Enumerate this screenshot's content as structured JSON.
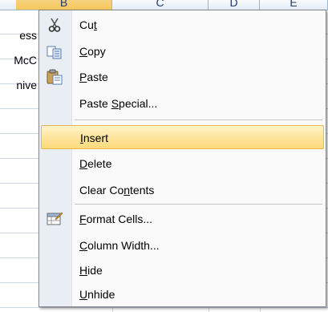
{
  "sheet": {
    "columns": [
      {
        "label": "B",
        "selected": true
      },
      {
        "label": "C",
        "selected": false
      },
      {
        "label": "D",
        "selected": false
      },
      {
        "label": "E",
        "selected": false
      }
    ],
    "cells": [
      "ess",
      "McC",
      "nive"
    ]
  },
  "menu": {
    "items": [
      {
        "pre": "Cu",
        "u": "t",
        "post": "",
        "icon": "scissors-icon"
      },
      {
        "pre": "",
        "u": "C",
        "post": "opy",
        "icon": "copy-icon"
      },
      {
        "pre": "",
        "u": "P",
        "post": "aste",
        "icon": "paste-icon"
      },
      {
        "pre": "Paste ",
        "u": "S",
        "post": "pecial...",
        "icon": ""
      },
      {
        "pre": "",
        "u": "I",
        "post": "nsert",
        "icon": ""
      },
      {
        "pre": "",
        "u": "D",
        "post": "elete",
        "icon": ""
      },
      {
        "pre": "Clear Co",
        "u": "n",
        "post": "tents",
        "icon": ""
      },
      {
        "pre": "",
        "u": "F",
        "post": "ormat Cells...",
        "icon": "format-cells-icon"
      },
      {
        "pre": "",
        "u": "C",
        "post": "olumn Width...",
        "icon": ""
      },
      {
        "pre": "",
        "u": "H",
        "post": "ide",
        "icon": ""
      },
      {
        "pre": "",
        "u": "U",
        "post": "nhide",
        "icon": ""
      }
    ],
    "highlighted": "Insert",
    "colors": {
      "highlight": "#fdd97a",
      "gutter": "#e9eef4",
      "border": "#868686"
    }
  }
}
